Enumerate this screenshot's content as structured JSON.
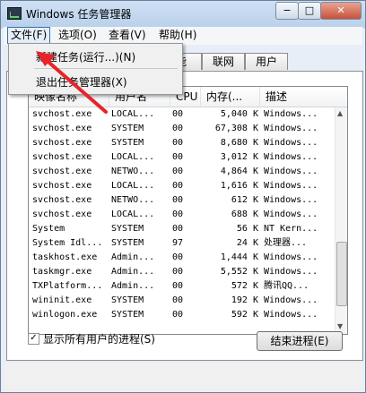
{
  "window": {
    "title": "Windows 任务管理器"
  },
  "title_controls": {
    "minimize": "−",
    "maximize": "□",
    "close": "✕"
  },
  "menu": {
    "file": "文件(F)",
    "options": "选项(O)",
    "view": "查看(V)",
    "help": "帮助(H)"
  },
  "file_menu": {
    "new_task": "新建任务(运行...)(N)",
    "exit": "退出任务管理器(X)"
  },
  "tabs": [
    {
      "label": "能"
    },
    {
      "label": "联网"
    },
    {
      "label": "用户"
    }
  ],
  "columns": {
    "image_name": "映像名称",
    "user": "用户名",
    "cpu": "CPU",
    "memory": "内存(...",
    "description": "描述"
  },
  "processes": [
    {
      "name": "svchost.exe",
      "user": "LOCAL...",
      "cpu": "00",
      "mem": "5,040 K",
      "desc": "Windows..."
    },
    {
      "name": "svchost.exe",
      "user": "SYSTEM",
      "cpu": "00",
      "mem": "67,308 K",
      "desc": "Windows..."
    },
    {
      "name": "svchost.exe",
      "user": "SYSTEM",
      "cpu": "00",
      "mem": "8,680 K",
      "desc": "Windows..."
    },
    {
      "name": "svchost.exe",
      "user": "LOCAL...",
      "cpu": "00",
      "mem": "3,012 K",
      "desc": "Windows..."
    },
    {
      "name": "svchost.exe",
      "user": "NETWO...",
      "cpu": "00",
      "mem": "4,864 K",
      "desc": "Windows..."
    },
    {
      "name": "svchost.exe",
      "user": "LOCAL...",
      "cpu": "00",
      "mem": "1,616 K",
      "desc": "Windows..."
    },
    {
      "name": "svchost.exe",
      "user": "NETWO...",
      "cpu": "00",
      "mem": "612 K",
      "desc": "Windows..."
    },
    {
      "name": "svchost.exe",
      "user": "LOCAL...",
      "cpu": "00",
      "mem": "688 K",
      "desc": "Windows..."
    },
    {
      "name": "System",
      "user": "SYSTEM",
      "cpu": "00",
      "mem": "56 K",
      "desc": "NT Kern..."
    },
    {
      "name": "System Idl...",
      "user": "SYSTEM",
      "cpu": "97",
      "mem": "24 K",
      "desc": "处理器..."
    },
    {
      "name": "taskhost.exe",
      "user": "Admin...",
      "cpu": "00",
      "mem": "1,444 K",
      "desc": "Windows..."
    },
    {
      "name": "taskmgr.exe",
      "user": "Admin...",
      "cpu": "00",
      "mem": "5,552 K",
      "desc": "Windows..."
    },
    {
      "name": "TXPlatform...",
      "user": "Admin...",
      "cpu": "00",
      "mem": "572 K",
      "desc": "腾讯QQ..."
    },
    {
      "name": "wininit.exe",
      "user": "SYSTEM",
      "cpu": "00",
      "mem": "192 K",
      "desc": "Windows..."
    },
    {
      "name": "winlogon.exe",
      "user": "SYSTEM",
      "cpu": "00",
      "mem": "592 K",
      "desc": "Windows..."
    }
  ],
  "show_all_users": {
    "label": "显示所有用户的进程(S)",
    "checked": true,
    "mark": "✓"
  },
  "end_process_button": "结束进程(E)",
  "scroll": {
    "up": "▲",
    "down": "▼"
  },
  "colors": {
    "annotation_arrow": "#e8242a",
    "menu_highlight": "#3e6ea6"
  }
}
